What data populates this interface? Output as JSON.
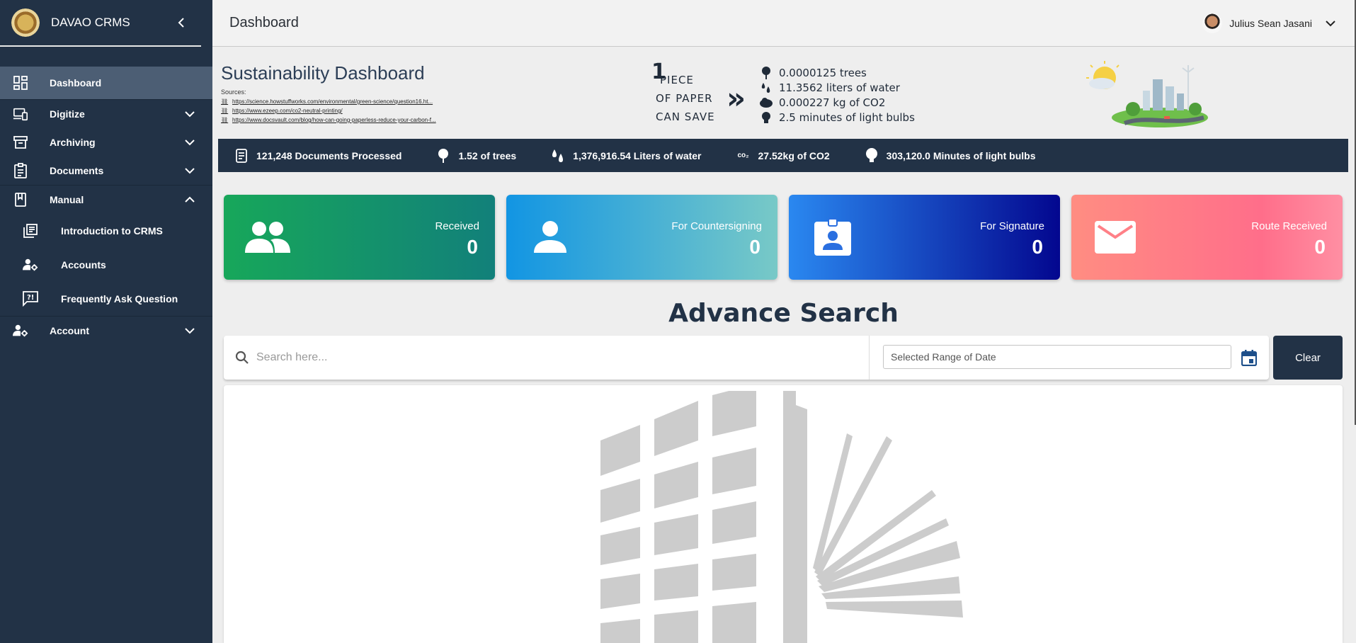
{
  "app": {
    "title": "DAVAO CRMS"
  },
  "sidebar": {
    "items": [
      {
        "label": "Dashboard",
        "icon": "dashboard-icon",
        "active": true
      },
      {
        "label": "Digitize",
        "icon": "devices-icon",
        "expandable": true
      },
      {
        "label": "Archiving",
        "icon": "archive-icon",
        "expandable": true
      },
      {
        "label": "Documents",
        "icon": "clipboard-icon",
        "expandable": true
      },
      {
        "label": "Manual",
        "icon": "book-icon",
        "expandable": true,
        "expanded": true
      }
    ],
    "manual_items": [
      {
        "label": "Introduction to CRMS",
        "icon": "library-books-icon"
      },
      {
        "label": "Accounts",
        "icon": "manage-accounts-icon"
      },
      {
        "label": "Frequently Ask Question",
        "icon": "quiz-icon"
      }
    ],
    "account": {
      "label": "Account",
      "icon": "manage-accounts-icon"
    }
  },
  "header": {
    "title": "Dashboard",
    "user_name": "Julius Sean Jasani"
  },
  "sustainability": {
    "title": "Sustainability Dashboard",
    "sources_label": "Sources:",
    "sources": [
      "https://science.howstuffworks.com/environmental/green-science/question16.ht...",
      "https://www.ezeep.com/co2-neutral-printing/",
      "https://www.docsvault.com/blog/how-can-going-paperless-reduce-your-carbon-f..."
    ],
    "one": "1",
    "piece": "PIECE",
    "of_paper": "OF PAPER",
    "can_save": "CAN SAVE",
    "savings": [
      {
        "icon": "tree-icon",
        "text": "0.0000125 trees"
      },
      {
        "icon": "water-drops-icon",
        "text": "11.3562 liters of water"
      },
      {
        "icon": "co2-cloud-icon",
        "text": "0.000227 kg of CO2"
      },
      {
        "icon": "lightbulb-icon",
        "text": "2.5 minutes of light bulbs"
      }
    ]
  },
  "stats_bar": [
    {
      "icon": "document-icon",
      "text": "121,248 Documents Processed"
    },
    {
      "icon": "tree-icon",
      "text": "1.52 of trees"
    },
    {
      "icon": "water-drops-icon",
      "text": "1,376,916.54 Liters of water"
    },
    {
      "icon": "co2-icon",
      "text": "27.52kg of CO2"
    },
    {
      "icon": "lightbulb-icon",
      "text": "303,120.0 Minutes of light bulbs"
    }
  ],
  "co2_glyph": "co₂",
  "cards": [
    {
      "label": "Received",
      "value": "0",
      "icon": "people-icon"
    },
    {
      "label": "For Countersigning",
      "value": "0",
      "icon": "person-icon"
    },
    {
      "label": "For Signature",
      "value": "0",
      "icon": "badge-icon"
    },
    {
      "label": "Route Received",
      "value": "0",
      "icon": "mail-icon"
    }
  ],
  "advance_search": {
    "title": "Advance Search",
    "search_placeholder": "Search here...",
    "date_placeholder": "Selected Range of Date",
    "clear_label": "Clear"
  },
  "colors": {
    "sidebar_bg": "#223246",
    "active_item": "#4c5e74",
    "received": "#17a75a",
    "countersigning": "#1295e3",
    "signature": "#2a88f0",
    "route_received": "#ff8d82"
  }
}
